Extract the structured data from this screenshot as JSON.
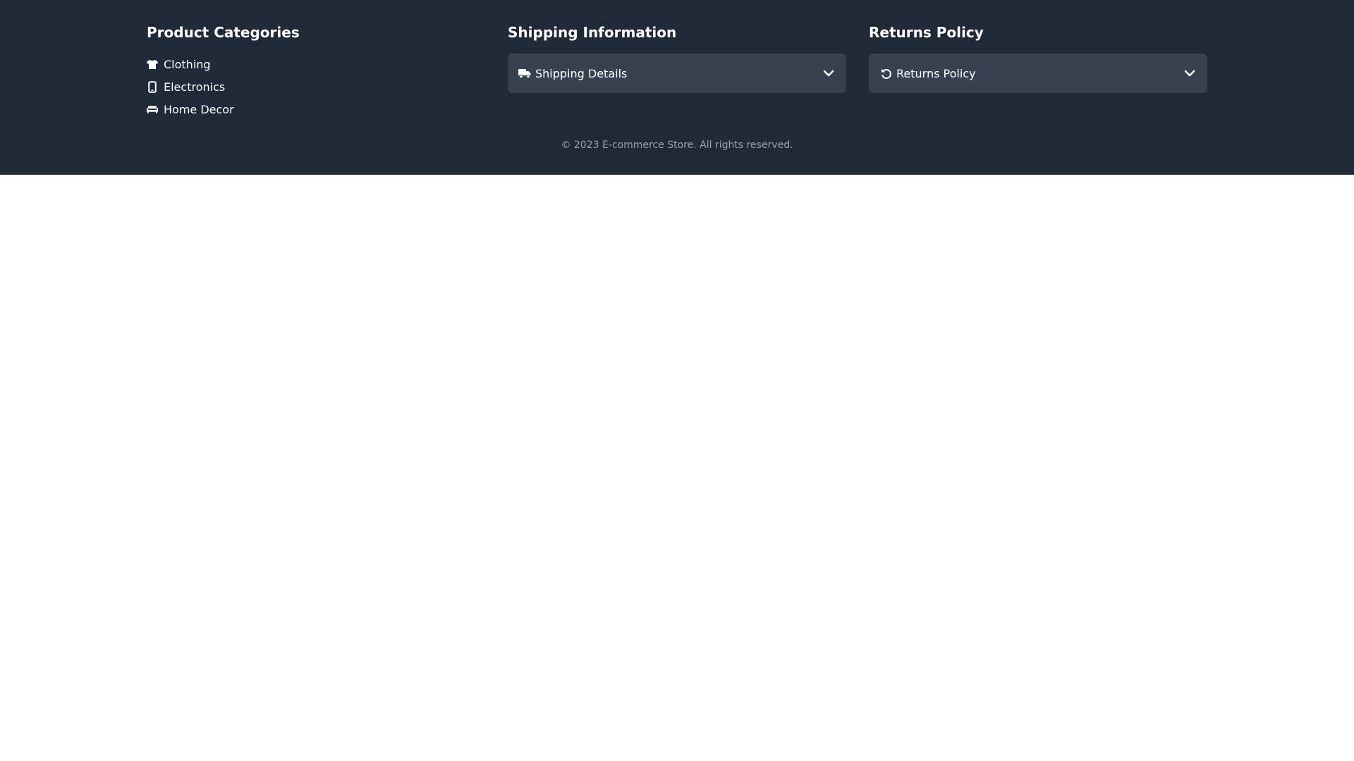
{
  "categories": {
    "title": "Product Categories",
    "items": [
      {
        "label": "Clothing",
        "icon": "tshirt-icon"
      },
      {
        "label": "Electronics",
        "icon": "mobile-phone-icon"
      },
      {
        "label": "Home Decor",
        "icon": "couch-icon"
      }
    ]
  },
  "shipping": {
    "title": "Shipping Information",
    "accordion_label": "Shipping Details",
    "icon": "truck-icon",
    "chevron": "chevron-down-icon"
  },
  "returns": {
    "title": "Returns Policy",
    "accordion_label": "Returns Policy",
    "icon": "undo-icon",
    "chevron": "chevron-down-icon"
  },
  "footer": {
    "copyright": "© 2023 E-commerce Store. All rights reserved."
  },
  "colors": {
    "footer_bg": "#1f2937",
    "accordion_bg": "#374151",
    "copyright_text": "#9ca3af",
    "page_bg": "#ffffff"
  }
}
